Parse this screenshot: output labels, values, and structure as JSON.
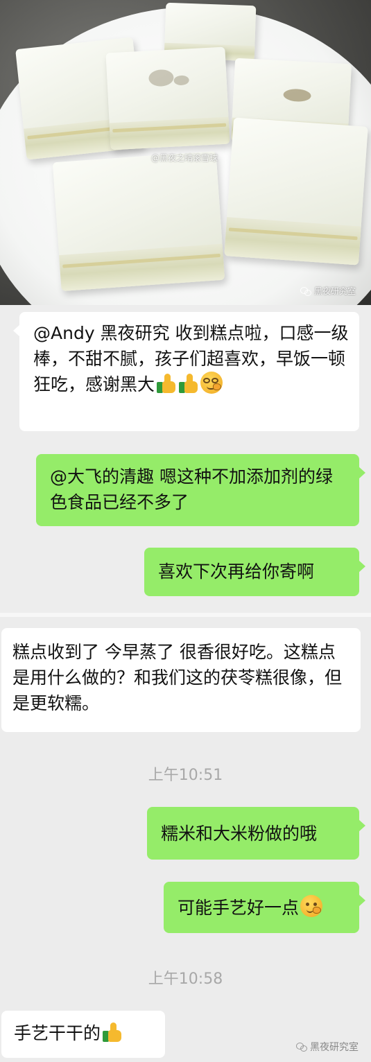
{
  "photo": {
    "watermark_weibo": "@黑夜之晴滚雪球",
    "watermark_account": "黑夜研究室"
  },
  "chat1": {
    "messages": [
      {
        "side": "left",
        "text": "@Andy 黑夜研究 收到糕点啦，口感一级棒，不甜不腻，孩子们超喜欢，早饭一顿狂吃，感谢黑大"
      },
      {
        "side": "right",
        "text": "@大飞的清趣 嗯这种不加添加剂的绿色食品已经不多了"
      },
      {
        "side": "right",
        "text": "喜欢下次再给你寄啊"
      }
    ]
  },
  "chat2": {
    "messages": [
      {
        "side": "left",
        "text": "糕点收到了 今早蒸了 很香很好吃。这糕点是用什么做的？和我们这的茯苓糕很像，但是更软糯。"
      },
      {
        "side": "time",
        "text": "上午10:51"
      },
      {
        "side": "right",
        "text": "糯米和大米粉做的哦"
      },
      {
        "side": "right",
        "text": "可能手艺好一点"
      },
      {
        "side": "time",
        "text": "上午10:58"
      },
      {
        "side": "left",
        "text": "手艺干干的"
      }
    ]
  },
  "footer": {
    "watermark": "黑夜研究室"
  },
  "colors": {
    "green_bubble": "#95ec69",
    "white_bubble": "#ffffff",
    "chat_bg": "#ededed",
    "time_text": "#a8a8a8"
  },
  "icons": [
    "thumbs-up-emoji",
    "smirk-face-emoji",
    "thinking-face-emoji",
    "wechat-logo-icon"
  ]
}
